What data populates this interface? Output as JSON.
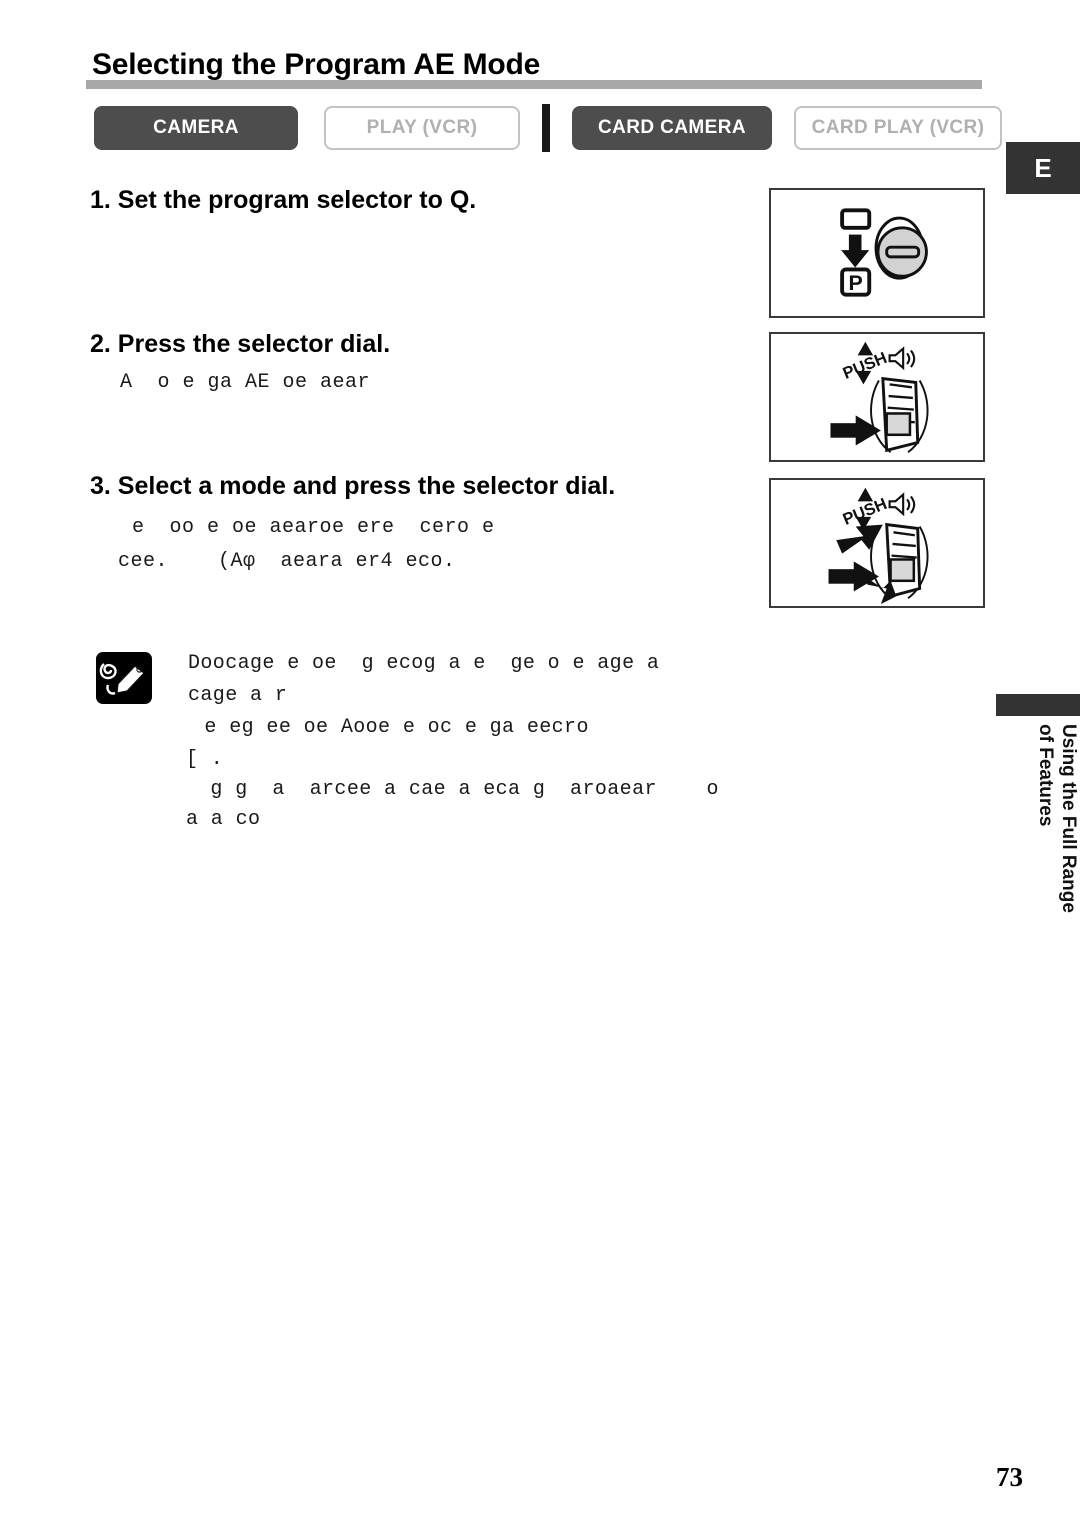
{
  "page": {
    "title": "Selecting the Program AE Mode",
    "language_tab": "E",
    "page_number": "73",
    "chapter_label_line1": "Using the Full Range",
    "chapter_label_line2": "of Features"
  },
  "mode_tabs": [
    {
      "label": "CAMERA",
      "state": "active",
      "name": "mode-tab-camera"
    },
    {
      "label": "PLAY (VCR)",
      "state": "inactive",
      "name": "mode-tab-play-vcr"
    },
    {
      "label": "CARD CAMERA",
      "state": "active",
      "name": "mode-tab-card-camera"
    },
    {
      "label": "CARD PLAY (VCR)",
      "state": "inactive",
      "name": "mode-tab-card-play-vcr"
    }
  ],
  "steps": [
    {
      "heading": "1. Set the program selector to Q.",
      "body": []
    },
    {
      "heading": "2. Press the selector dial.",
      "body": [
        "A  o e ga AE oe aear"
      ]
    },
    {
      "heading": "3. Select a mode and press the selector dial.",
      "body": [
        "e  oo e oe aearoe ere  cero e",
        "cee.    (Aφ  aeara er4 eco."
      ]
    }
  ],
  "notes": {
    "icon": "note-pencil-icon",
    "lines": [
      "Doocage e oe  g ecog a e  ge o e age a",
      "cage a r",
      " e eg ee oe Aooe e oc e ga eecro",
      "[ .",
      " g g  a  arcee a cae a eca g  aroaear    o",
      "a a co"
    ]
  },
  "figures": [
    {
      "name": "figure-program-selector-dial",
      "caption_symbols": [
        "auto-rectangle-icon",
        "down-arrow-icon",
        "p-mode-icon",
        "rotary-dial-icon"
      ]
    },
    {
      "name": "figure-press-selector-dial",
      "caption_symbols": [
        "push-label",
        "up-arrow-icon",
        "down-arrow-icon",
        "speaker-icon",
        "press-arrow-icon",
        "selector-dial-icon"
      ]
    },
    {
      "name": "figure-select-mode-selector-dial",
      "caption_symbols": [
        "push-label",
        "up-arrow-icon",
        "down-arrow-icon",
        "speaker-icon",
        "press-arrow-icon",
        "scroll-up-arrow-icon",
        "scroll-down-arrow-icon",
        "selector-dial-icon"
      ]
    }
  ],
  "figure_labels": {
    "push": "PUSH",
    "p_mode": "P"
  },
  "colors": {
    "tab_active_bg": "#4d4d4d",
    "tab_inactive_border": "#c3c3c3",
    "tab_inactive_text": "#b0b0b0",
    "title_rule": "#a8a8a8",
    "chapter_tab": "#333333",
    "text": "#000000"
  }
}
